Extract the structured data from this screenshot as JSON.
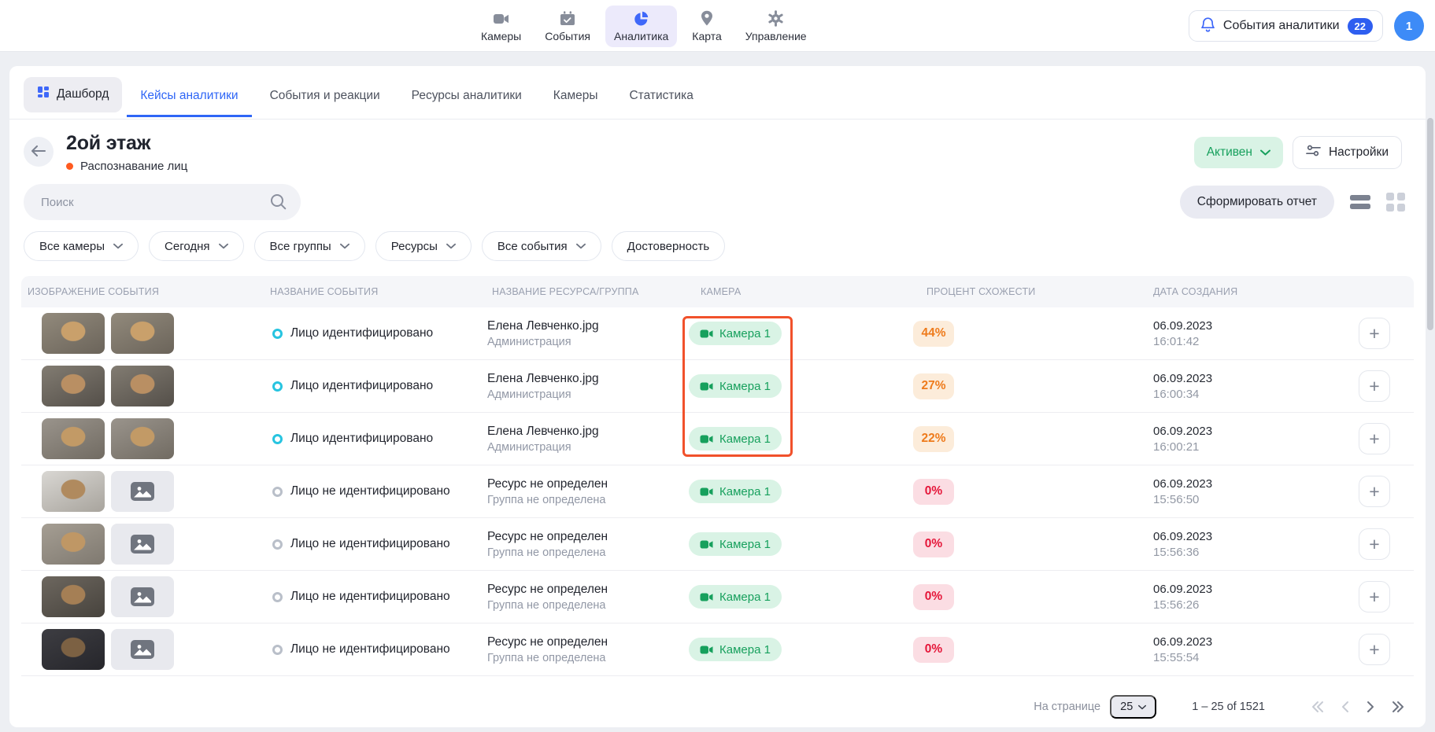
{
  "topbar": {
    "nav": [
      {
        "label": "Камеры",
        "icon": "video-camera-icon",
        "active": false
      },
      {
        "label": "События",
        "icon": "calendar-icon",
        "active": false
      },
      {
        "label": "Аналитика",
        "icon": "pie-chart-icon",
        "active": true
      },
      {
        "label": "Карта",
        "icon": "map-pin-icon",
        "active": false
      },
      {
        "label": "Управление",
        "icon": "gear-icon",
        "active": false
      }
    ],
    "events_button": {
      "label": "События аналитики",
      "icon": "bell-icon",
      "badge": "22"
    },
    "avatar": "1"
  },
  "tabs": [
    {
      "label": "Дашборд",
      "icon": "dashboard-icon",
      "active": false
    },
    {
      "label": "Кейсы аналитики",
      "active": true
    },
    {
      "label": "События и реакции",
      "active": false
    },
    {
      "label": "Ресурсы аналитики",
      "active": false
    },
    {
      "label": "Камеры",
      "active": false
    },
    {
      "label": "Статистика",
      "active": false
    }
  ],
  "case": {
    "title": "2ой этаж",
    "type": "Распознавание лиц",
    "status": "Активен",
    "settings_label": "Настройки"
  },
  "toolbar": {
    "search_placeholder": "Поиск",
    "report_button": "Сформировать отчет"
  },
  "filters": [
    {
      "label": "Все камеры",
      "chevron": true
    },
    {
      "label": "Сегодня",
      "chevron": true
    },
    {
      "label": "Все группы",
      "chevron": true
    },
    {
      "label": "Ресурсы",
      "chevron": true
    },
    {
      "label": "Все события",
      "chevron": true
    },
    {
      "label": "Достоверность",
      "chevron": false
    }
  ],
  "table": {
    "columns": [
      "ИЗОБРАЖЕНИЕ СОБЫТИЯ",
      "НАЗВАНИЕ СОБЫТИЯ",
      "НАЗВАНИЕ РЕСУРСА/ГРУППА",
      "КАМЕРА",
      "ПРОЦЕНТ СХОЖЕСТИ",
      "ДАТА СОЗДАНИЯ"
    ],
    "rows": [
      {
        "identified": true,
        "event": "Лицо идентифицировано",
        "resource": "Елена Левченко.jpg",
        "group": "Администрация",
        "camera": "Камера 1",
        "percent": "44%",
        "date": "06.09.2023",
        "time": "16:01:42",
        "highlighted": true
      },
      {
        "identified": true,
        "event": "Лицо идентифицировано",
        "resource": "Елена Левченко.jpg",
        "group": "Администрация",
        "camera": "Камера 1",
        "percent": "27%",
        "date": "06.09.2023",
        "time": "16:00:34",
        "highlighted": true
      },
      {
        "identified": true,
        "event": "Лицо идентифицировано",
        "resource": "Елена Левченко.jpg",
        "group": "Администрация",
        "camera": "Камера 1",
        "percent": "22%",
        "date": "06.09.2023",
        "time": "16:00:21",
        "highlighted": true
      },
      {
        "identified": false,
        "event": "Лицо не идентифицировано",
        "resource": "Ресурс не определен",
        "group": "Группа не определена",
        "camera": "Камера 1",
        "percent": "0%",
        "date": "06.09.2023",
        "time": "15:56:50",
        "highlighted": false
      },
      {
        "identified": false,
        "event": "Лицо не идентифицировано",
        "resource": "Ресурс не определен",
        "group": "Группа не определена",
        "camera": "Камера 1",
        "percent": "0%",
        "date": "06.09.2023",
        "time": "15:56:36",
        "highlighted": false
      },
      {
        "identified": false,
        "event": "Лицо не идентифицировано",
        "resource": "Ресурс не определен",
        "group": "Группа не определена",
        "camera": "Камера 1",
        "percent": "0%",
        "date": "06.09.2023",
        "time": "15:56:26",
        "highlighted": false
      },
      {
        "identified": false,
        "event": "Лицо не идентифицировано",
        "resource": "Ресурс не определен",
        "group": "Группа не определена",
        "camera": "Камера 1",
        "percent": "0%",
        "date": "06.09.2023",
        "time": "15:55:54",
        "highlighted": false
      }
    ]
  },
  "pagination": {
    "per_page_label": "На странице",
    "per_page": "25",
    "range": "1 – 25 of 1521"
  },
  "colors": {
    "accent_blue": "#2f66f6",
    "status_green": "#17a05d",
    "status_green_bg": "#d9f3e5",
    "percent_warm": "#ee7b1c",
    "percent_zero": "#e5173a",
    "annotation_red": "#f1512b",
    "case_type_dot": "#ff5a1f"
  }
}
